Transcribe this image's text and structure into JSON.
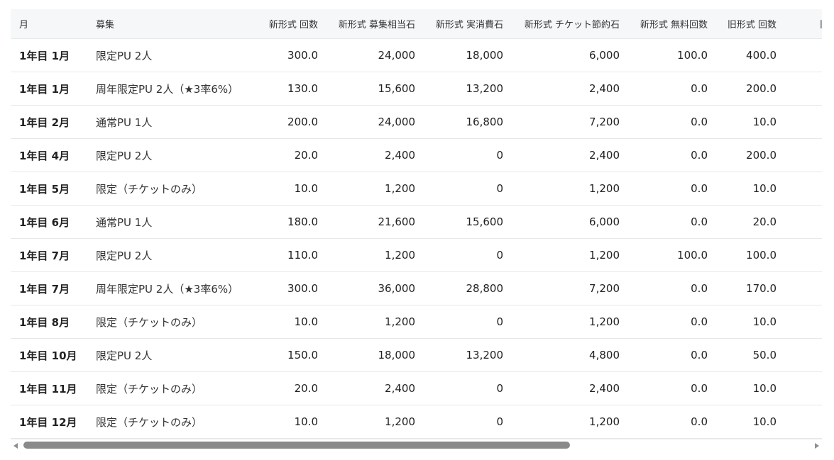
{
  "table": {
    "headers": [
      "月",
      "募集",
      "新形式 回数",
      "新形式 募集相当石",
      "新形式 実消費石",
      "新形式 チケット節約石",
      "新形式 無料回数",
      "旧形式 回数",
      "旧形式 募集相当石"
    ],
    "rows": [
      [
        "1年目 1月",
        "限定PU 2人",
        "300.0",
        "24,000",
        "18,000",
        "6,000",
        "100.0",
        "400.0",
        ""
      ],
      [
        "1年目 1月",
        "周年限定PU 2人（★3率6%）",
        "130.0",
        "15,600",
        "13,200",
        "2,400",
        "0.0",
        "200.0",
        ""
      ],
      [
        "1年目 2月",
        "通常PU 1人",
        "200.0",
        "24,000",
        "16,800",
        "7,200",
        "0.0",
        "10.0",
        ""
      ],
      [
        "1年目 4月",
        "限定PU 2人",
        "20.0",
        "2,400",
        "0",
        "2,400",
        "0.0",
        "200.0",
        ""
      ],
      [
        "1年目 5月",
        "限定（チケットのみ）",
        "10.0",
        "1,200",
        "0",
        "1,200",
        "0.0",
        "10.0",
        ""
      ],
      [
        "1年目 6月",
        "通常PU 1人",
        "180.0",
        "21,600",
        "15,600",
        "6,000",
        "0.0",
        "20.0",
        ""
      ],
      [
        "1年目 7月",
        "限定PU 2人",
        "110.0",
        "1,200",
        "0",
        "1,200",
        "100.0",
        "100.0",
        ""
      ],
      [
        "1年目 7月",
        "周年限定PU 2人（★3率6%）",
        "300.0",
        "36,000",
        "28,800",
        "7,200",
        "0.0",
        "170.0",
        ""
      ],
      [
        "1年目 8月",
        "限定（チケットのみ）",
        "10.0",
        "1,200",
        "0",
        "1,200",
        "0.0",
        "10.0",
        ""
      ],
      [
        "1年目 10月",
        "限定PU 2人",
        "150.0",
        "18,000",
        "13,200",
        "4,800",
        "0.0",
        "50.0",
        ""
      ],
      [
        "1年目 11月",
        "限定（チケットのみ）",
        "20.0",
        "2,400",
        "0",
        "2,400",
        "0.0",
        "10.0",
        ""
      ],
      [
        "1年目 12月",
        "限定（チケットのみ）",
        "10.0",
        "1,200",
        "0",
        "1,200",
        "0.0",
        "10.0",
        ""
      ]
    ]
  },
  "scrollbar": {
    "left_arrow_icon": "triangle-left-icon",
    "right_arrow_icon": "triangle-right-icon"
  },
  "colors": {
    "header_bg": "#f5f7f9",
    "row_border": "#e8e8e8",
    "scroll_thumb": "#8a8a8a"
  }
}
